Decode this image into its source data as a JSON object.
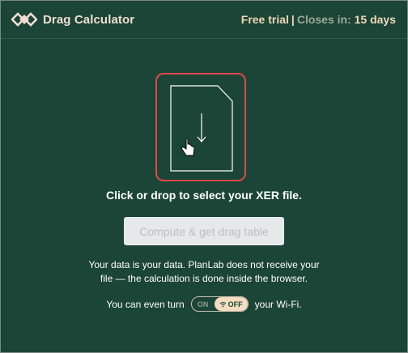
{
  "header": {
    "app_title": "Drag Calculator",
    "trial_label": "Free trial",
    "separator": "|",
    "closes_label": "Closes in:",
    "days_left": "15 days"
  },
  "dropzone": {
    "caption": "Click or drop to select your XER file.",
    "icons": [
      "file-icon",
      "down-arrow-icon",
      "hand-cursor-icon"
    ]
  },
  "compute_button": {
    "label": "Compute & get drag table",
    "state": "disabled"
  },
  "privacy": {
    "line1": "Your data is your data. PlanLab does not receive your",
    "line2": "file — the calculation is done inside the browser."
  },
  "wifi": {
    "prefix": "You can even turn",
    "toggle_on_label": "ON",
    "toggle_off_label": "OFF",
    "suffix": "your Wi-Fi.",
    "selected": "OFF"
  },
  "colors": {
    "background": "#1b4536",
    "highlight_border": "#e0474a",
    "accent": "#f4dcc0"
  }
}
